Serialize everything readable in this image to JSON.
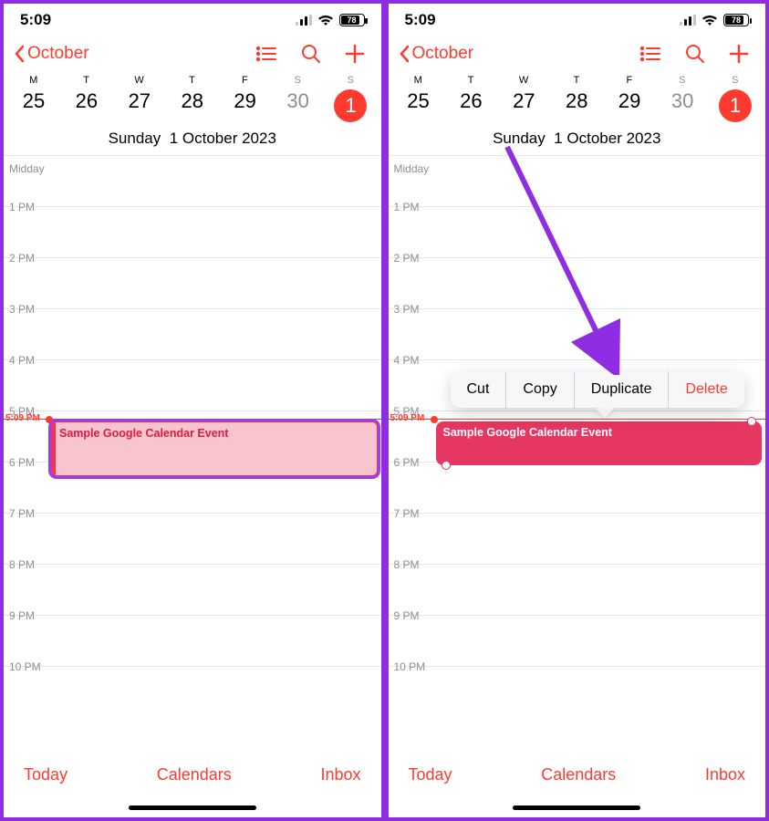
{
  "status": {
    "time": "5:09",
    "battery_pct": "78"
  },
  "nav": {
    "back_label": "October"
  },
  "week": {
    "dow": [
      "M",
      "T",
      "W",
      "T",
      "F",
      "S",
      "S"
    ],
    "dates": [
      "25",
      "26",
      "27",
      "28",
      "29",
      "30",
      "1"
    ]
  },
  "date_header": {
    "weekday": "Sunday",
    "date": "1 October 2023"
  },
  "hours": [
    "Midday",
    "1 PM",
    "2 PM",
    "3 PM",
    "4 PM",
    "5 PM",
    "6 PM",
    "7 PM",
    "8 PM",
    "9 PM",
    "10 PM"
  ],
  "now_label": "5:09 PM",
  "event": {
    "title": "Sample Google Calendar Event"
  },
  "context_menu": {
    "cut": "Cut",
    "copy": "Copy",
    "duplicate": "Duplicate",
    "delete": "Delete"
  },
  "footer": {
    "today": "Today",
    "calendars": "Calendars",
    "inbox": "Inbox"
  }
}
